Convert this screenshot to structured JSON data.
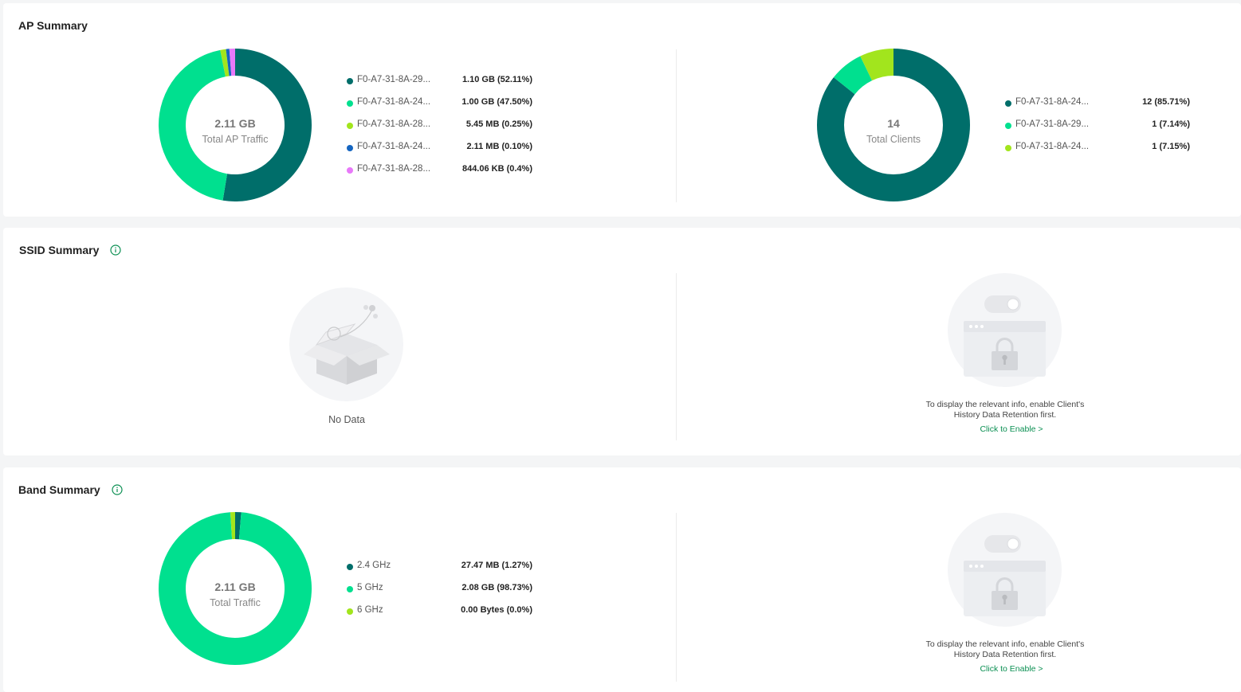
{
  "ap_summary": {
    "title": "AP Summary",
    "traffic": {
      "center_value": "2.11 GB",
      "center_label": "Total AP Traffic",
      "items": [
        {
          "name": "F0-A7-31-8A-29...",
          "value": "1.10 GB (52.11%)",
          "percent": 52.11,
          "color": "#006e6a"
        },
        {
          "name": "F0-A7-31-8A-24...",
          "value": "1.00 GB (47.50%)",
          "percent": 43.9,
          "color": "#00e08f"
        },
        {
          "name": "F0-A7-31-8A-28...",
          "value": "5.45 MB (0.25%)",
          "percent": 1.2,
          "color": "#a2e51d"
        },
        {
          "name": "F0-A7-31-8A-24...",
          "value": "2.11 MB (0.10%)",
          "percent": 0.7,
          "color": "#1565c0"
        },
        {
          "name": "F0-A7-31-8A-28...",
          "value": "844.06 KB (0.4%)",
          "percent": 1.2,
          "color": "#e879f9"
        }
      ]
    },
    "clients": {
      "center_value": "14",
      "center_label": "Total Clients",
      "items": [
        {
          "name": "F0-A7-31-8A-24...",
          "value": "12 (85.71%)",
          "percent": 85.71,
          "color": "#006e6a"
        },
        {
          "name": "F0-A7-31-8A-29...",
          "value": "1 (7.14%)",
          "percent": 7.14,
          "color": "#00e08f"
        },
        {
          "name": "F0-A7-31-8A-24...",
          "value": "1 (7.15%)",
          "percent": 7.15,
          "color": "#a2e51d"
        }
      ]
    }
  },
  "ssid_summary": {
    "title": "SSID Summary",
    "no_data": "No Data",
    "hint_line1": "To display the relevant info, enable Client's",
    "hint_line2": "History Data Retention first.",
    "enable_link": "Click to Enable >"
  },
  "band_summary": {
    "title": "Band Summary",
    "center_value": "2.11 GB",
    "center_label": "Total Traffic",
    "items": [
      {
        "name": "2.4 GHz",
        "value": "27.47 MB (1.27%)",
        "percent": 1.27,
        "color": "#006e6a"
      },
      {
        "name": "5 GHz",
        "value": "2.08 GB (98.73%)",
        "percent": 97.73,
        "color": "#00e08f"
      },
      {
        "name": "6 GHz",
        "value": "0.00 Bytes (0.0%)",
        "percent": 1.0,
        "color": "#a2e51d"
      }
    ],
    "hint_line1": "To display the relevant info, enable Client's",
    "hint_line2": "History Data Retention first.",
    "enable_link": "Click to Enable >"
  },
  "colors": {
    "accent": "#0a8f52",
    "info_icon": "#0a8f52"
  },
  "icons": {
    "info": "info-icon",
    "no_data": "empty-box-icon",
    "locked": "locked-window-icon"
  }
}
